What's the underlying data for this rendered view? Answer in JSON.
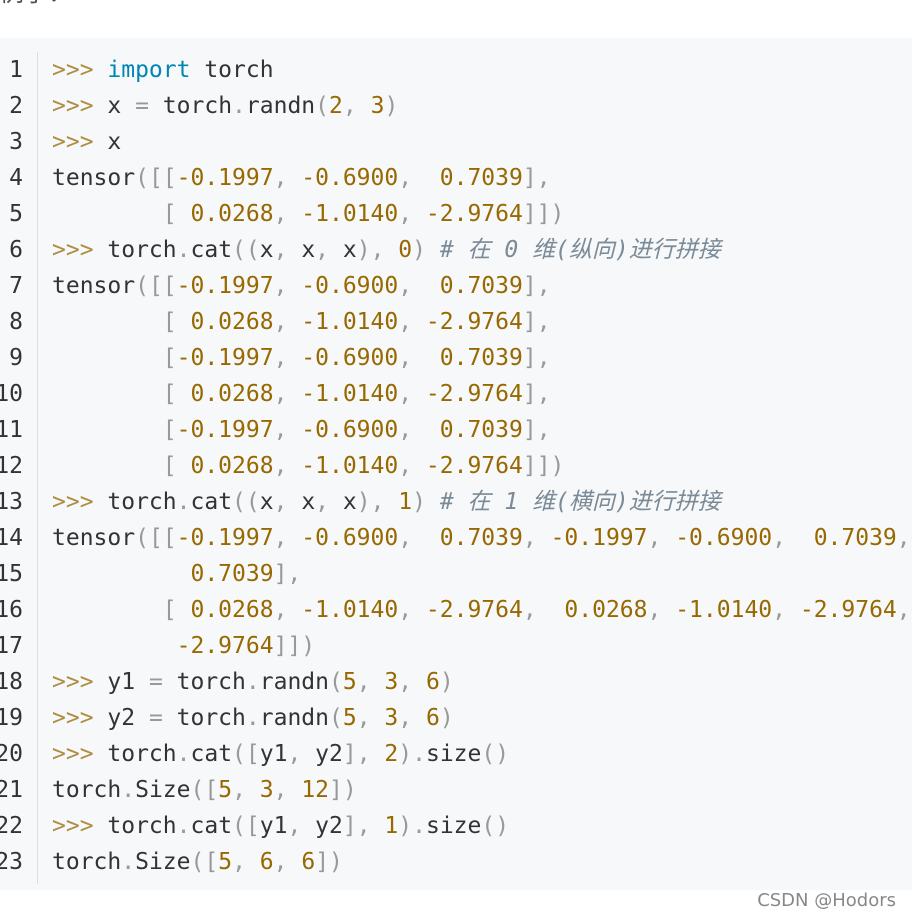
{
  "top_text": "例子：",
  "watermark": "CSDN @Hodors",
  "lines": [
    {
      "n": "1",
      "tokens": [
        [
          "prompt",
          ">>> "
        ],
        [
          "keyword",
          "import"
        ],
        [
          "ident",
          " torch"
        ]
      ]
    },
    {
      "n": "2",
      "tokens": [
        [
          "prompt",
          ">>> "
        ],
        [
          "ident",
          "x "
        ],
        [
          "punct",
          "="
        ],
        [
          "ident",
          " torch"
        ],
        [
          "punct",
          "."
        ],
        [
          "ident",
          "randn"
        ],
        [
          "punct",
          "("
        ],
        [
          "number",
          "2"
        ],
        [
          "punct",
          ", "
        ],
        [
          "number",
          "3"
        ],
        [
          "punct",
          ")"
        ]
      ]
    },
    {
      "n": "3",
      "tokens": [
        [
          "prompt",
          ">>> "
        ],
        [
          "ident",
          "x"
        ]
      ]
    },
    {
      "n": "4",
      "tokens": [
        [
          "ident",
          "tensor"
        ],
        [
          "punct",
          "([["
        ],
        [
          "number",
          "-0.1997"
        ],
        [
          "punct",
          ", "
        ],
        [
          "number",
          "-0.6900"
        ],
        [
          "punct",
          ",  "
        ],
        [
          "number",
          "0.7039"
        ],
        [
          "punct",
          "],"
        ]
      ]
    },
    {
      "n": "5",
      "tokens": [
        [
          "space",
          "        "
        ],
        [
          "punct",
          "[ "
        ],
        [
          "number",
          "0.0268"
        ],
        [
          "punct",
          ", "
        ],
        [
          "number",
          "-1.0140"
        ],
        [
          "punct",
          ", "
        ],
        [
          "number",
          "-2.9764"
        ],
        [
          "punct",
          "]])"
        ]
      ]
    },
    {
      "n": "6",
      "tokens": [
        [
          "prompt",
          ">>> "
        ],
        [
          "ident",
          "torch"
        ],
        [
          "punct",
          "."
        ],
        [
          "ident",
          "cat"
        ],
        [
          "punct",
          "(("
        ],
        [
          "ident",
          "x"
        ],
        [
          "punct",
          ", "
        ],
        [
          "ident",
          "x"
        ],
        [
          "punct",
          ", "
        ],
        [
          "ident",
          "x"
        ],
        [
          "punct",
          "), "
        ],
        [
          "number",
          "0"
        ],
        [
          "punct",
          ") "
        ],
        [
          "comment",
          "# 在 0 维(纵向)进行拼接"
        ]
      ]
    },
    {
      "n": "7",
      "tokens": [
        [
          "ident",
          "tensor"
        ],
        [
          "punct",
          "([["
        ],
        [
          "number",
          "-0.1997"
        ],
        [
          "punct",
          ", "
        ],
        [
          "number",
          "-0.6900"
        ],
        [
          "punct",
          ",  "
        ],
        [
          "number",
          "0.7039"
        ],
        [
          "punct",
          "],"
        ]
      ]
    },
    {
      "n": "8",
      "tokens": [
        [
          "space",
          "        "
        ],
        [
          "punct",
          "[ "
        ],
        [
          "number",
          "0.0268"
        ],
        [
          "punct",
          ", "
        ],
        [
          "number",
          "-1.0140"
        ],
        [
          "punct",
          ", "
        ],
        [
          "number",
          "-2.9764"
        ],
        [
          "punct",
          "],"
        ]
      ]
    },
    {
      "n": "9",
      "tokens": [
        [
          "space",
          "        "
        ],
        [
          "punct",
          "["
        ],
        [
          "number",
          "-0.1997"
        ],
        [
          "punct",
          ", "
        ],
        [
          "number",
          "-0.6900"
        ],
        [
          "punct",
          ",  "
        ],
        [
          "number",
          "0.7039"
        ],
        [
          "punct",
          "],"
        ]
      ]
    },
    {
      "n": "10",
      "tokens": [
        [
          "space",
          "        "
        ],
        [
          "punct",
          "[ "
        ],
        [
          "number",
          "0.0268"
        ],
        [
          "punct",
          ", "
        ],
        [
          "number",
          "-1.0140"
        ],
        [
          "punct",
          ", "
        ],
        [
          "number",
          "-2.9764"
        ],
        [
          "punct",
          "],"
        ]
      ]
    },
    {
      "n": "11",
      "tokens": [
        [
          "space",
          "        "
        ],
        [
          "punct",
          "["
        ],
        [
          "number",
          "-0.1997"
        ],
        [
          "punct",
          ", "
        ],
        [
          "number",
          "-0.6900"
        ],
        [
          "punct",
          ",  "
        ],
        [
          "number",
          "0.7039"
        ],
        [
          "punct",
          "],"
        ]
      ]
    },
    {
      "n": "12",
      "tokens": [
        [
          "space",
          "        "
        ],
        [
          "punct",
          "[ "
        ],
        [
          "number",
          "0.0268"
        ],
        [
          "punct",
          ", "
        ],
        [
          "number",
          "-1.0140"
        ],
        [
          "punct",
          ", "
        ],
        [
          "number",
          "-2.9764"
        ],
        [
          "punct",
          "]])"
        ]
      ]
    },
    {
      "n": "13",
      "tokens": [
        [
          "prompt",
          ">>> "
        ],
        [
          "ident",
          "torch"
        ],
        [
          "punct",
          "."
        ],
        [
          "ident",
          "cat"
        ],
        [
          "punct",
          "(("
        ],
        [
          "ident",
          "x"
        ],
        [
          "punct",
          ", "
        ],
        [
          "ident",
          "x"
        ],
        [
          "punct",
          ", "
        ],
        [
          "ident",
          "x"
        ],
        [
          "punct",
          "), "
        ],
        [
          "number",
          "1"
        ],
        [
          "punct",
          ") "
        ],
        [
          "comment",
          "# 在 1 维(横向)进行拼接"
        ]
      ]
    },
    {
      "n": "14",
      "tokens": [
        [
          "ident",
          "tensor"
        ],
        [
          "punct",
          "([["
        ],
        [
          "number",
          "-0.1997"
        ],
        [
          "punct",
          ", "
        ],
        [
          "number",
          "-0.6900"
        ],
        [
          "punct",
          ",  "
        ],
        [
          "number",
          "0.7039"
        ],
        [
          "punct",
          ", "
        ],
        [
          "number",
          "-0.1997"
        ],
        [
          "punct",
          ", "
        ],
        [
          "number",
          "-0.6900"
        ],
        [
          "punct",
          ",  "
        ],
        [
          "number",
          "0.7039"
        ],
        [
          "punct",
          ","
        ]
      ]
    },
    {
      "n": "15",
      "tokens": [
        [
          "space",
          "          "
        ],
        [
          "number",
          "0.7039"
        ],
        [
          "punct",
          "],"
        ]
      ]
    },
    {
      "n": "16",
      "tokens": [
        [
          "space",
          "        "
        ],
        [
          "punct",
          "[ "
        ],
        [
          "number",
          "0.0268"
        ],
        [
          "punct",
          ", "
        ],
        [
          "number",
          "-1.0140"
        ],
        [
          "punct",
          ", "
        ],
        [
          "number",
          "-2.9764"
        ],
        [
          "punct",
          ",  "
        ],
        [
          "number",
          "0.0268"
        ],
        [
          "punct",
          ", "
        ],
        [
          "number",
          "-1.0140"
        ],
        [
          "punct",
          ", "
        ],
        [
          "number",
          "-2.9764"
        ],
        [
          "punct",
          ","
        ]
      ]
    },
    {
      "n": "17",
      "tokens": [
        [
          "space",
          "         "
        ],
        [
          "number",
          "-2.9764"
        ],
        [
          "punct",
          "]])"
        ]
      ]
    },
    {
      "n": "18",
      "tokens": [
        [
          "prompt",
          ">>> "
        ],
        [
          "ident",
          "y1 "
        ],
        [
          "punct",
          "="
        ],
        [
          "ident",
          " torch"
        ],
        [
          "punct",
          "."
        ],
        [
          "ident",
          "randn"
        ],
        [
          "punct",
          "("
        ],
        [
          "number",
          "5"
        ],
        [
          "punct",
          ", "
        ],
        [
          "number",
          "3"
        ],
        [
          "punct",
          ", "
        ],
        [
          "number",
          "6"
        ],
        [
          "punct",
          ")"
        ]
      ]
    },
    {
      "n": "19",
      "tokens": [
        [
          "prompt",
          ">>> "
        ],
        [
          "ident",
          "y2 "
        ],
        [
          "punct",
          "="
        ],
        [
          "ident",
          " torch"
        ],
        [
          "punct",
          "."
        ],
        [
          "ident",
          "randn"
        ],
        [
          "punct",
          "("
        ],
        [
          "number",
          "5"
        ],
        [
          "punct",
          ", "
        ],
        [
          "number",
          "3"
        ],
        [
          "punct",
          ", "
        ],
        [
          "number",
          "6"
        ],
        [
          "punct",
          ")"
        ]
      ]
    },
    {
      "n": "20",
      "tokens": [
        [
          "prompt",
          ">>> "
        ],
        [
          "ident",
          "torch"
        ],
        [
          "punct",
          "."
        ],
        [
          "ident",
          "cat"
        ],
        [
          "punct",
          "(["
        ],
        [
          "ident",
          "y1"
        ],
        [
          "punct",
          ", "
        ],
        [
          "ident",
          "y2"
        ],
        [
          "punct",
          "], "
        ],
        [
          "number",
          "2"
        ],
        [
          "punct",
          ")."
        ],
        [
          "ident",
          "size"
        ],
        [
          "punct",
          "()"
        ]
      ]
    },
    {
      "n": "21",
      "tokens": [
        [
          "ident",
          "torch"
        ],
        [
          "punct",
          "."
        ],
        [
          "ident",
          "Size"
        ],
        [
          "punct",
          "(["
        ],
        [
          "number",
          "5"
        ],
        [
          "punct",
          ", "
        ],
        [
          "number",
          "3"
        ],
        [
          "punct",
          ", "
        ],
        [
          "number",
          "12"
        ],
        [
          "punct",
          "])"
        ]
      ]
    },
    {
      "n": "22",
      "tokens": [
        [
          "prompt",
          ">>> "
        ],
        [
          "ident",
          "torch"
        ],
        [
          "punct",
          "."
        ],
        [
          "ident",
          "cat"
        ],
        [
          "punct",
          "(["
        ],
        [
          "ident",
          "y1"
        ],
        [
          "punct",
          ", "
        ],
        [
          "ident",
          "y2"
        ],
        [
          "punct",
          "], "
        ],
        [
          "number",
          "1"
        ],
        [
          "punct",
          ")."
        ],
        [
          "ident",
          "size"
        ],
        [
          "punct",
          "()"
        ]
      ]
    },
    {
      "n": "23",
      "tokens": [
        [
          "ident",
          "torch"
        ],
        [
          "punct",
          "."
        ],
        [
          "ident",
          "Size"
        ],
        [
          "punct",
          "(["
        ],
        [
          "number",
          "5"
        ],
        [
          "punct",
          ", "
        ],
        [
          "number",
          "6"
        ],
        [
          "punct",
          ", "
        ],
        [
          "number",
          "6"
        ],
        [
          "punct",
          "])"
        ]
      ]
    }
  ]
}
